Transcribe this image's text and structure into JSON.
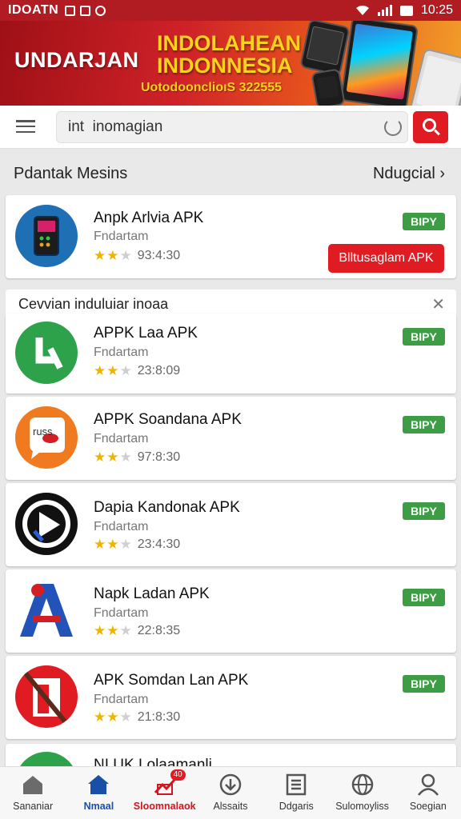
{
  "status_bar": {
    "carrier": "IDOATN",
    "time": "10:25"
  },
  "banner": {
    "left_text": "UNDARJAN",
    "title": "INDOLAHEAN INDONNESIA",
    "subtitle": "UotodoonclioıS 322555"
  },
  "search": {
    "value": "int  inomagian"
  },
  "section": {
    "title": "Pdantak Mesins",
    "link": "Ndugcial"
  },
  "featured": {
    "name": "Anpk Arlvia APK",
    "developer": "Fndartam",
    "rating": "93:4:30",
    "badge": "BIPY",
    "download_label": "Blltusaglam APK"
  },
  "list_header": "Cevvian induluiar inoaa",
  "apps": [
    {
      "name": "APPK Laa APK",
      "developer": "Fndartam",
      "rating": "23:8:09",
      "badge": "BIPY",
      "icon": "green-arrow-icon"
    },
    {
      "name": "APPK Soandana APK",
      "developer": "Fndartam",
      "rating": "97:8:30",
      "badge": "BIPY",
      "icon": "orange-chat-icon"
    },
    {
      "name": "Dapia Kandonak APK",
      "developer": "Fndartam",
      "rating": "23:4:30",
      "badge": "BIPY",
      "icon": "play-icon"
    },
    {
      "name": "Napk Ladan APK",
      "developer": "Fndartam",
      "rating": "22:8:35",
      "badge": "BIPY",
      "icon": "letter-a-icon"
    },
    {
      "name": "APK Somdan Lan APK",
      "developer": "Fndartam",
      "rating": "21:8:30",
      "badge": "BIPY",
      "icon": "pen-icon"
    },
    {
      "name": "NI UK Lolaamanli",
      "developer": "",
      "rating": "",
      "badge": "",
      "icon": "partial-app-icon"
    }
  ],
  "bottom_nav": [
    {
      "label": "Sananiar",
      "icon": "home-icon"
    },
    {
      "label": "Nmaal",
      "icon": "house-blue-icon"
    },
    {
      "label": "Sloomnalaok",
      "icon": "trending-icon",
      "badge": "40"
    },
    {
      "label": "Alssaits",
      "icon": "download-icon"
    },
    {
      "label": "Ddgaris",
      "icon": "list-icon"
    },
    {
      "label": "Sulomoyliss",
      "icon": "globe-icon"
    },
    {
      "label": "Soegian",
      "icon": "user-icon"
    }
  ],
  "colors": {
    "accent": "#e01b22",
    "badge": "#3c9d45",
    "nav_active": "#1a4fa8"
  }
}
